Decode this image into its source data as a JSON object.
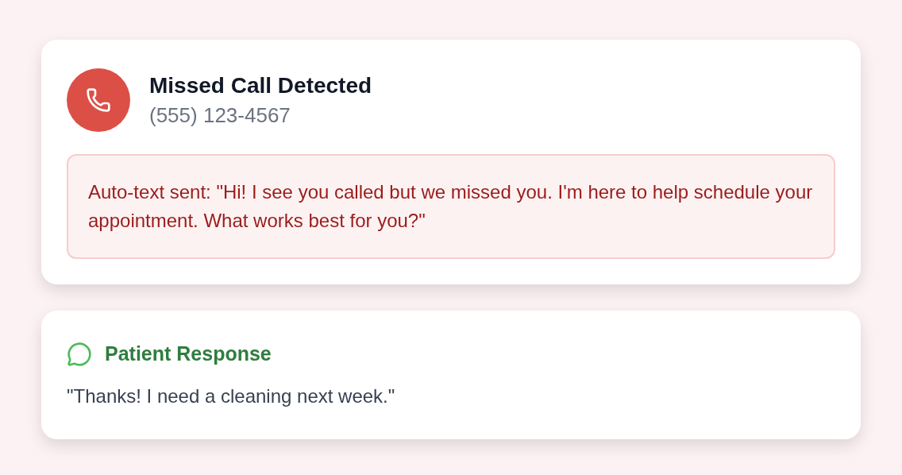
{
  "missed_call": {
    "title": "Missed Call Detected",
    "phone": "(555) 123-4567",
    "auto_text": "Auto-text sent: \"Hi! I see you called but we missed you. I'm here to help schedule your appointment. What works best for you?\""
  },
  "response": {
    "title": "Patient Response",
    "message": "\"Thanks! I need a cleaning next week.\""
  }
}
